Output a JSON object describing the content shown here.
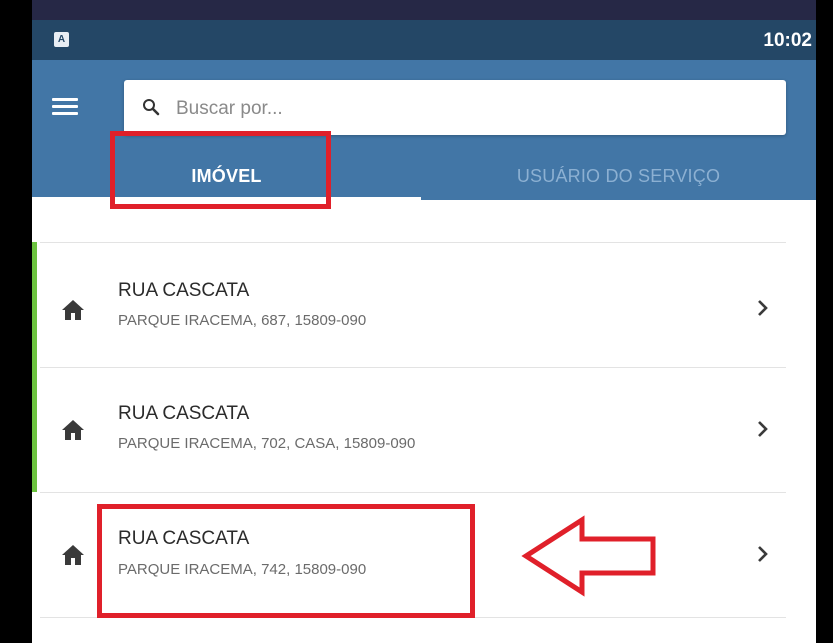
{
  "status_bar": {
    "notification_icon": "A",
    "time": "10:02"
  },
  "app_bar": {
    "menu_icon": "hamburger-icon",
    "search": {
      "placeholder": "Buscar por...",
      "value": ""
    },
    "tabs": [
      {
        "label": "IMÓVEL",
        "selected": true
      },
      {
        "label": "USUÁRIO DO SERVIÇO",
        "selected": false
      }
    ]
  },
  "list": {
    "items": [
      {
        "title": "RUA CASCATA",
        "subtitle": "PARQUE IRACEMA, 687, 15809-090",
        "icon": "home-icon"
      },
      {
        "title": "RUA CASCATA",
        "subtitle": "PARQUE IRACEMA, 702, CASA, 15809-090",
        "icon": "home-icon"
      },
      {
        "title": "RUA CASCATA",
        "subtitle": "PARQUE IRACEMA, 742, 15809-090",
        "icon": "home-icon"
      }
    ]
  },
  "colors": {
    "status_bar": "#244766",
    "app_bar": "#4276a6",
    "accent_bar": "#6cc33f",
    "annotation": "#e0202a"
  }
}
